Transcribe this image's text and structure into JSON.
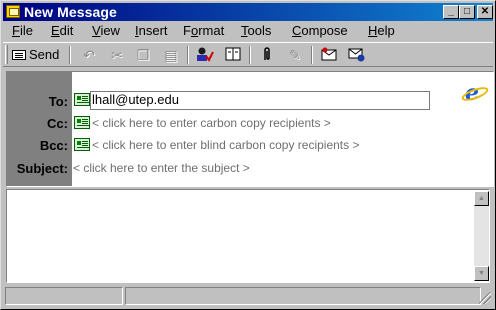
{
  "window": {
    "title": "New Message",
    "controls": {
      "minimize": "_",
      "maximize": "□",
      "close": "✕"
    }
  },
  "menu": [
    {
      "key": "F",
      "rest": "ile"
    },
    {
      "key": "E",
      "rest": "dit"
    },
    {
      "key": "V",
      "rest": "iew"
    },
    {
      "key": "I",
      "rest": "nsert"
    },
    {
      "key": "o",
      "pre": "F",
      "rest": "rmat"
    },
    {
      "key": "T",
      "rest": "ools"
    },
    {
      "key": "C",
      "rest": "ompose"
    },
    {
      "key": "H",
      "rest": "elp"
    }
  ],
  "toolbar": {
    "send_label": "Send",
    "icons": [
      "undo-icon",
      "cut-icon",
      "copy-icon",
      "paste-icon",
      "check-names-icon",
      "address-book-icon",
      "attach-icon",
      "signature-icon",
      "insert-card-icon",
      "security-icon"
    ]
  },
  "header": {
    "to_label": "To:",
    "to_value": "lhall@utep.edu",
    "cc_label": "Cc:",
    "cc_hint": "< click here to enter carbon copy recipients >",
    "bcc_label": "Bcc:",
    "bcc_hint": "< click here to enter blind carbon copy recipients >",
    "subject_label": "Subject:",
    "subject_hint": "< click here to enter the subject >",
    "logo": "e"
  },
  "body": {
    "text": ""
  },
  "colors": {
    "titlebar_start": "#000080",
    "titlebar_end": "#1084d0",
    "label_column": "#808080",
    "chrome": "#c0c0c0"
  }
}
